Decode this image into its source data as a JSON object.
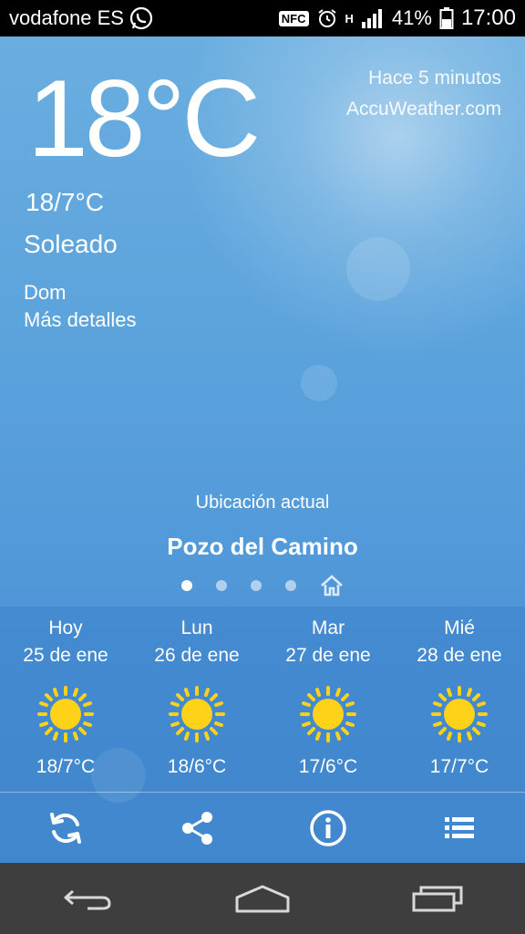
{
  "status_bar": {
    "carrier": "vodafone ES",
    "nfc": "NFC",
    "network_type": "H",
    "battery_percent": "41%",
    "time": "17:00"
  },
  "current": {
    "temperature": "18°C",
    "range": "18/7°C",
    "condition": "Soleado",
    "day": "Dom",
    "more_details": "Más detalles",
    "updated": "Hace 5 minutos",
    "provider": "AccuWeather.com"
  },
  "location": {
    "caption": "Ubicación actual",
    "name": "Pozo del Camino"
  },
  "forecast": [
    {
      "day": "Hoy",
      "date": "25 de ene",
      "temps": "18/7°C",
      "icon": "sun-icon"
    },
    {
      "day": "Lun",
      "date": "26 de ene",
      "temps": "18/6°C",
      "icon": "sun-icon"
    },
    {
      "day": "Mar",
      "date": "27 de ene",
      "temps": "17/6°C",
      "icon": "sun-icon"
    },
    {
      "day": "Mié",
      "date": "28 de ene",
      "temps": "17/7°C",
      "icon": "sun-icon"
    }
  ],
  "toolbar": {
    "icons": [
      "refresh-icon",
      "share-icon",
      "info-icon",
      "menu-list-icon"
    ]
  },
  "colors": {
    "sky_top": "#6aaee0",
    "sky_bottom": "#4a8fd3",
    "sun_yellow": "#ffd21a",
    "nav_bar": "#3e3e3e"
  }
}
